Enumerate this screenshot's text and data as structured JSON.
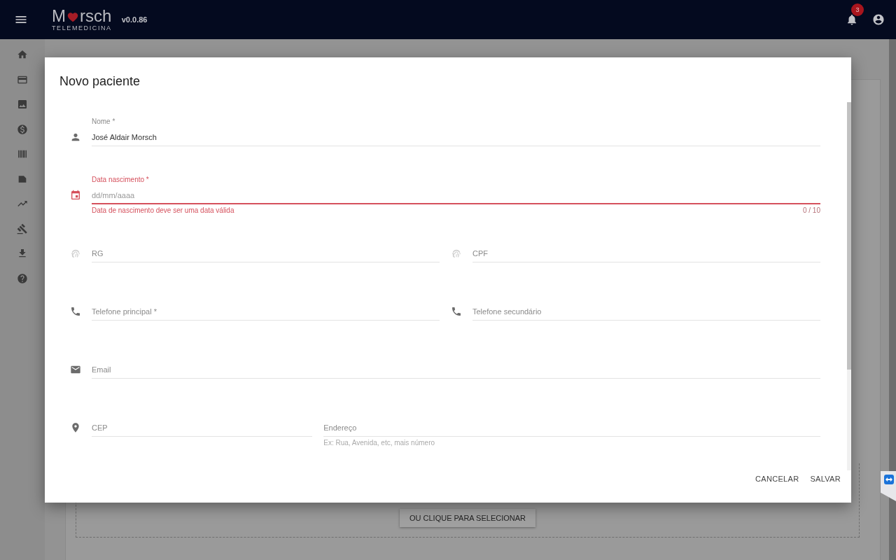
{
  "app_bar": {
    "logo": {
      "lead": "M",
      "rest": "rsch",
      "tagline": "TELEMEDICINA"
    },
    "version": "v0.0.86",
    "notification_count": "3"
  },
  "page": {
    "upload_button": "OU CLIQUE PARA SELECIONAR"
  },
  "dialog": {
    "title": "Novo paciente",
    "rows": [
      {
        "fields": [
          {
            "kind": "person",
            "label": "Nome *",
            "value": "José Aldair Morsch",
            "invalid": false
          }
        ]
      },
      {
        "fields": [
          {
            "kind": "calendar",
            "label": "Data nascimento *",
            "placeholder": "dd/mm/aaaa",
            "invalid": true,
            "error": "Data de nascimento deve ser uma data válida",
            "counter": "0 / 10"
          }
        ]
      },
      {
        "fields": [
          {
            "kind": "fingerprint",
            "label": "RG",
            "invalid": false
          },
          {
            "kind": "fingerprint",
            "label": "CPF",
            "invalid": false
          }
        ]
      },
      {
        "fields": [
          {
            "kind": "phone",
            "label": "Telefone principal *",
            "invalid": false
          },
          {
            "kind": "phone",
            "label": "Telefone secundário",
            "invalid": false
          }
        ]
      },
      {
        "fields": [
          {
            "kind": "email",
            "label": "Email",
            "invalid": false
          }
        ]
      },
      {
        "fields": [
          {
            "kind": "pin",
            "label": "CEP",
            "invalid": false
          },
          {
            "kind": "none",
            "label": "Endereço",
            "hint": "Ex: Rua, Avenida, etc, mais número",
            "invalid": false
          }
        ]
      }
    ],
    "actions": [
      "CANCELAR",
      "SALVAR"
    ]
  }
}
